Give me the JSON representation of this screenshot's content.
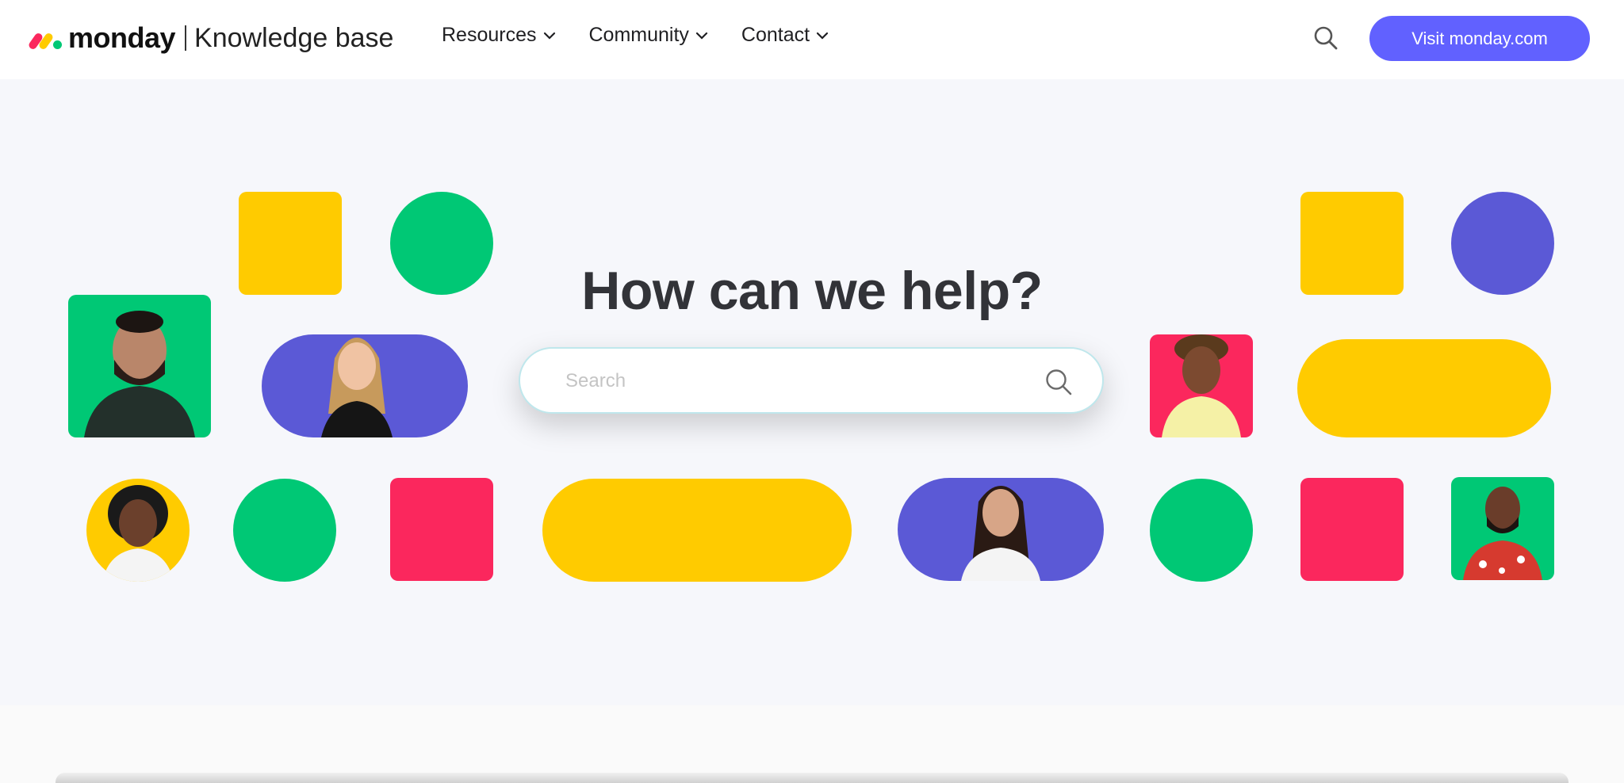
{
  "header": {
    "logo_word": "monday",
    "logo_suffix": "Knowledge base",
    "nav": [
      {
        "label": "Resources"
      },
      {
        "label": "Community"
      },
      {
        "label": "Contact"
      }
    ],
    "cta_label": "Visit monday.com"
  },
  "hero": {
    "title": "How can we help?",
    "search_placeholder": "Search"
  },
  "colors": {
    "accent": "#6161ff",
    "yellow": "#ffcb00",
    "green": "#00c875",
    "purple": "#5b59d6",
    "red": "#fb275d"
  }
}
